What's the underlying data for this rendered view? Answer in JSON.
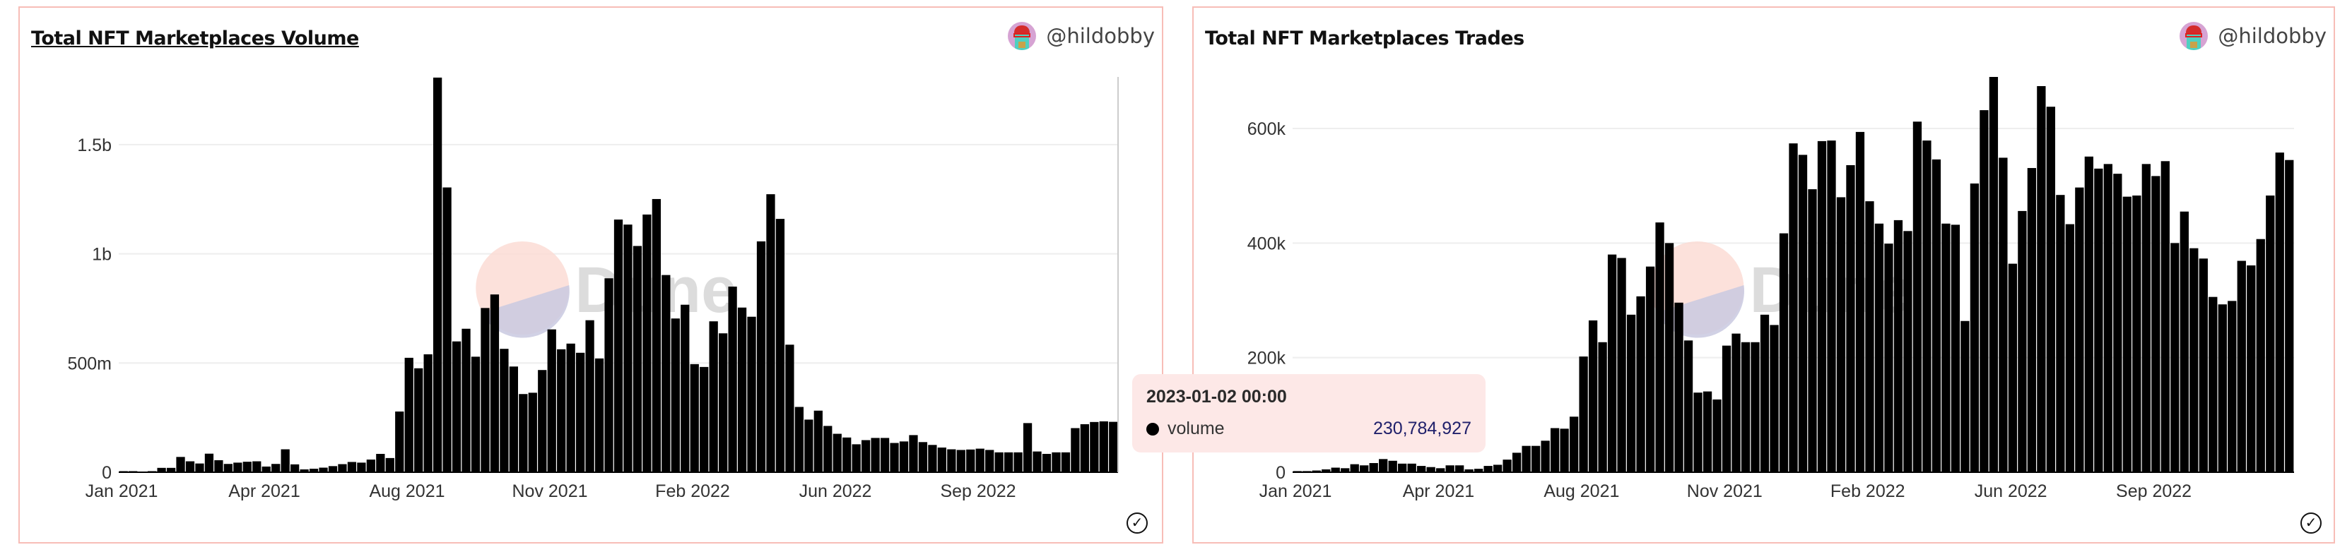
{
  "author": "@hildobby",
  "tooltip": {
    "title": "2023-01-02 00:00",
    "series": "volume",
    "value": "230,784,927"
  },
  "colors": {
    "bar": "#000000",
    "border": "#f7bdb7",
    "tooltip_bg": "#fde8e7",
    "tooltip_value": "#20206b",
    "grid": "#eeeeee"
  },
  "watermark": "Dune",
  "chart_data": [
    {
      "type": "bar",
      "title": "Total NFT Marketplaces Volume",
      "series_name": "volume",
      "x_start": "2021-01-04",
      "x_interval": "1 week",
      "ylim": [
        0,
        1810000000
      ],
      "yticks": [
        {
          "value": 0,
          "label": "0"
        },
        {
          "value": 500000000,
          "label": "500m"
        },
        {
          "value": 1000000000,
          "label": "1b"
        },
        {
          "value": 1500000000,
          "label": "1.5b"
        }
      ],
      "xticks": [
        {
          "index": 0,
          "label": "Jan 2021"
        },
        {
          "index": 15,
          "label": "Apr 2021"
        },
        {
          "index": 30,
          "label": "Aug 2021"
        },
        {
          "index": 45,
          "label": "Nov 2021"
        },
        {
          "index": 60,
          "label": "Feb 2022"
        },
        {
          "index": 75,
          "label": "Jun 2022"
        },
        {
          "index": 90,
          "label": "Sep 2022"
        }
      ],
      "grid": true,
      "values_millions": [
        5,
        5,
        3,
        5,
        20,
        20,
        70,
        50,
        40,
        85,
        55,
        38,
        44,
        48,
        50,
        26,
        38,
        105,
        36,
        13,
        16,
        21,
        28,
        37,
        47,
        44,
        58,
        84,
        65,
        278,
        524,
        476,
        540,
        1807,
        1304,
        599,
        657,
        529,
        752,
        814,
        565,
        484,
        358,
        364,
        468,
        654,
        563,
        589,
        547,
        696,
        521,
        888,
        1157,
        1134,
        1036,
        1180,
        1251,
        903,
        704,
        767,
        495,
        482,
        691,
        636,
        850,
        754,
        712,
        1057,
        1273,
        1160,
        584,
        299,
        241,
        282,
        212,
        176,
        159,
        128,
        147,
        157,
        157,
        134,
        141,
        170,
        138,
        125,
        113,
        105,
        102,
        104,
        108,
        102,
        91,
        91,
        91,
        225,
        95,
        84,
        91,
        91,
        202,
        220,
        230,
        233,
        230.78
      ]
    },
    {
      "type": "bar",
      "title": "Total NFT Marketplaces Trades",
      "series_name": "trades",
      "x_start": "2021-01-04",
      "x_interval": "1 week",
      "ylim": [
        0,
        690000
      ],
      "yticks": [
        {
          "value": 0,
          "label": "0"
        },
        {
          "value": 200000,
          "label": "200k"
        },
        {
          "value": 400000,
          "label": "400k"
        },
        {
          "value": 600000,
          "label": "600k"
        }
      ],
      "xticks": [
        {
          "index": 0,
          "label": "Jan 2021"
        },
        {
          "index": 15,
          "label": "Apr 2021"
        },
        {
          "index": 30,
          "label": "Aug 2021"
        },
        {
          "index": 45,
          "label": "Nov 2021"
        },
        {
          "index": 60,
          "label": "Feb 2022"
        },
        {
          "index": 75,
          "label": "Jun 2022"
        },
        {
          "index": 90,
          "label": "Sep 2022"
        }
      ],
      "grid": true,
      "values_thousands": [
        2,
        2,
        3,
        5,
        8,
        7,
        14,
        12,
        16,
        23,
        20,
        15,
        15,
        11,
        9,
        7,
        12,
        12,
        5,
        6,
        11,
        13,
        22,
        34,
        46,
        46,
        55,
        77,
        76,
        97,
        202,
        265,
        227,
        380,
        374,
        275,
        307,
        359,
        436,
        400,
        296,
        230,
        139,
        141,
        127,
        221,
        242,
        227,
        227,
        275,
        257,
        417,
        574,
        554,
        494,
        578,
        579,
        480,
        536,
        594,
        473,
        434,
        399,
        440,
        421,
        612,
        579,
        546,
        434,
        432,
        264,
        504,
        632,
        690,
        549,
        364,
        456,
        531,
        674,
        638,
        484,
        433,
        497,
        551,
        530,
        538,
        521,
        481,
        483,
        538,
        517,
        543,
        400,
        455,
        391,
        373,
        306,
        293,
        299,
        369,
        361,
        407,
        483,
        558,
        545
      ]
    }
  ]
}
